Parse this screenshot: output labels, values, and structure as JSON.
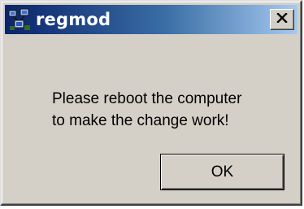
{
  "window": {
    "title": "regmod",
    "icon": "app-network-icon",
    "close_icon": "close-icon"
  },
  "message": {
    "line1": "Please reboot the computer",
    "line2": "to make the change work!"
  },
  "buttons": {
    "ok_label": "OK"
  },
  "colors": {
    "titlebar_start": "#0a246a",
    "titlebar_end": "#a6caf0",
    "dialog_face": "#d4d0c8"
  }
}
